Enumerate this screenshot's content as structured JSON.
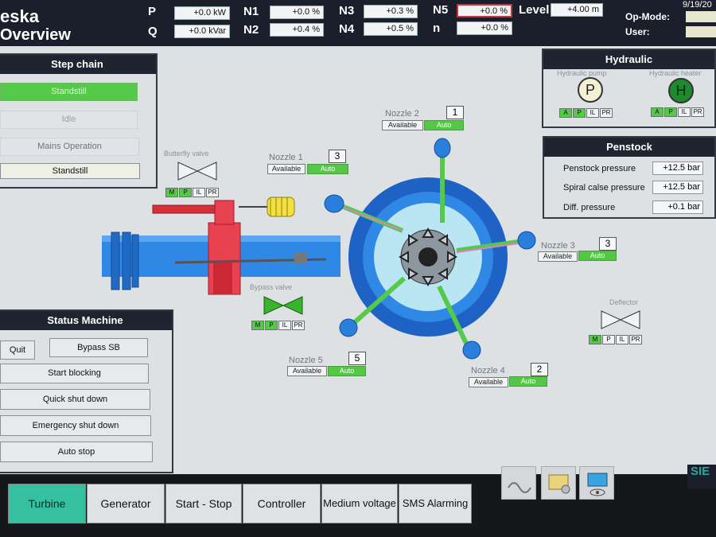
{
  "header": {
    "brand_line1": "eska",
    "brand_line2": "Overview",
    "date": "9/19/20",
    "op_mode_label": "Op-Mode:",
    "user_label": "User:",
    "metrics": [
      {
        "label": "P",
        "value": "+0.0 kW"
      },
      {
        "label": "Q",
        "value": "+0.0 kVar"
      },
      {
        "label": "N1",
        "value": "+0.0 %"
      },
      {
        "label": "N2",
        "value": "+0.4 %"
      },
      {
        "label": "N3",
        "value": "+0.3 %"
      },
      {
        "label": "N4",
        "value": "+0.5 %"
      },
      {
        "label": "N5",
        "value": "+0.0 %"
      },
      {
        "label": "n",
        "value": "+0.0 %"
      },
      {
        "label": "Level",
        "value": "+4.00 m"
      }
    ]
  },
  "step_chain": {
    "title": "Step chain",
    "buttons": [
      "Standstill",
      "Idle",
      "Mains Operation",
      "Standstill"
    ]
  },
  "status_machine": {
    "title": "Status Machine",
    "buttons": [
      "Quit",
      "Bypass SB",
      "Start blocking",
      "Quick shut down",
      "Emergency shut down",
      "Auto stop"
    ]
  },
  "hydraulic": {
    "title": "Hydraulic",
    "pump_label": "Hydraulic pump",
    "pump_symbol": "P",
    "heater_label": "Hydraulic heater",
    "heater_symbol": "H",
    "pump_modes": [
      "A",
      "P",
      "IL",
      "PR"
    ],
    "heater_modes": [
      "A",
      "P",
      "IL",
      "PR"
    ]
  },
  "penstock": {
    "title": "Penstock",
    "rows": [
      {
        "label": "Penstock pressure",
        "value": "+12.5 bar"
      },
      {
        "label": "Spiral calse pressure",
        "value": "+12.5 bar"
      },
      {
        "label": "Diff. pressure",
        "value": "+0.1 bar"
      }
    ]
  },
  "valves": {
    "butterfly_label": "Butterfly valve",
    "bypass_label": "Bypass valve",
    "deflector_label": "Deflector",
    "modes": [
      "M",
      "P",
      "IL",
      "PR"
    ]
  },
  "nozzles": [
    {
      "label": "Nozzle 1",
      "number": "3",
      "available": "Available",
      "mode": "Auto"
    },
    {
      "label": "Nozzle 2",
      "number": "1",
      "available": "Available",
      "mode": "Auto"
    },
    {
      "label": "Nozzle 3",
      "number": "3",
      "available": "Available",
      "mode": "Auto"
    },
    {
      "label": "Nozzle 4",
      "number": "2",
      "available": "Available",
      "mode": "Auto"
    },
    {
      "label": "Nozzle 5",
      "number": "5",
      "available": "Available",
      "mode": "Auto"
    }
  ],
  "tabs": [
    "Turbine",
    "Generator",
    "Start - Stop",
    "Controller",
    "Medium voltage",
    "SMS Alarming"
  ],
  "active_tab": "Turbine",
  "brand_footer": "SIE",
  "colors": {
    "accent_green": "#55c948",
    "active_tab": "#35c1a0",
    "pipe_blue": "#2f87e6",
    "header_bg": "#1a1f2b"
  },
  "icons": [
    "wave-icon",
    "settings-tools-icon",
    "monitor-eye-icon"
  ]
}
